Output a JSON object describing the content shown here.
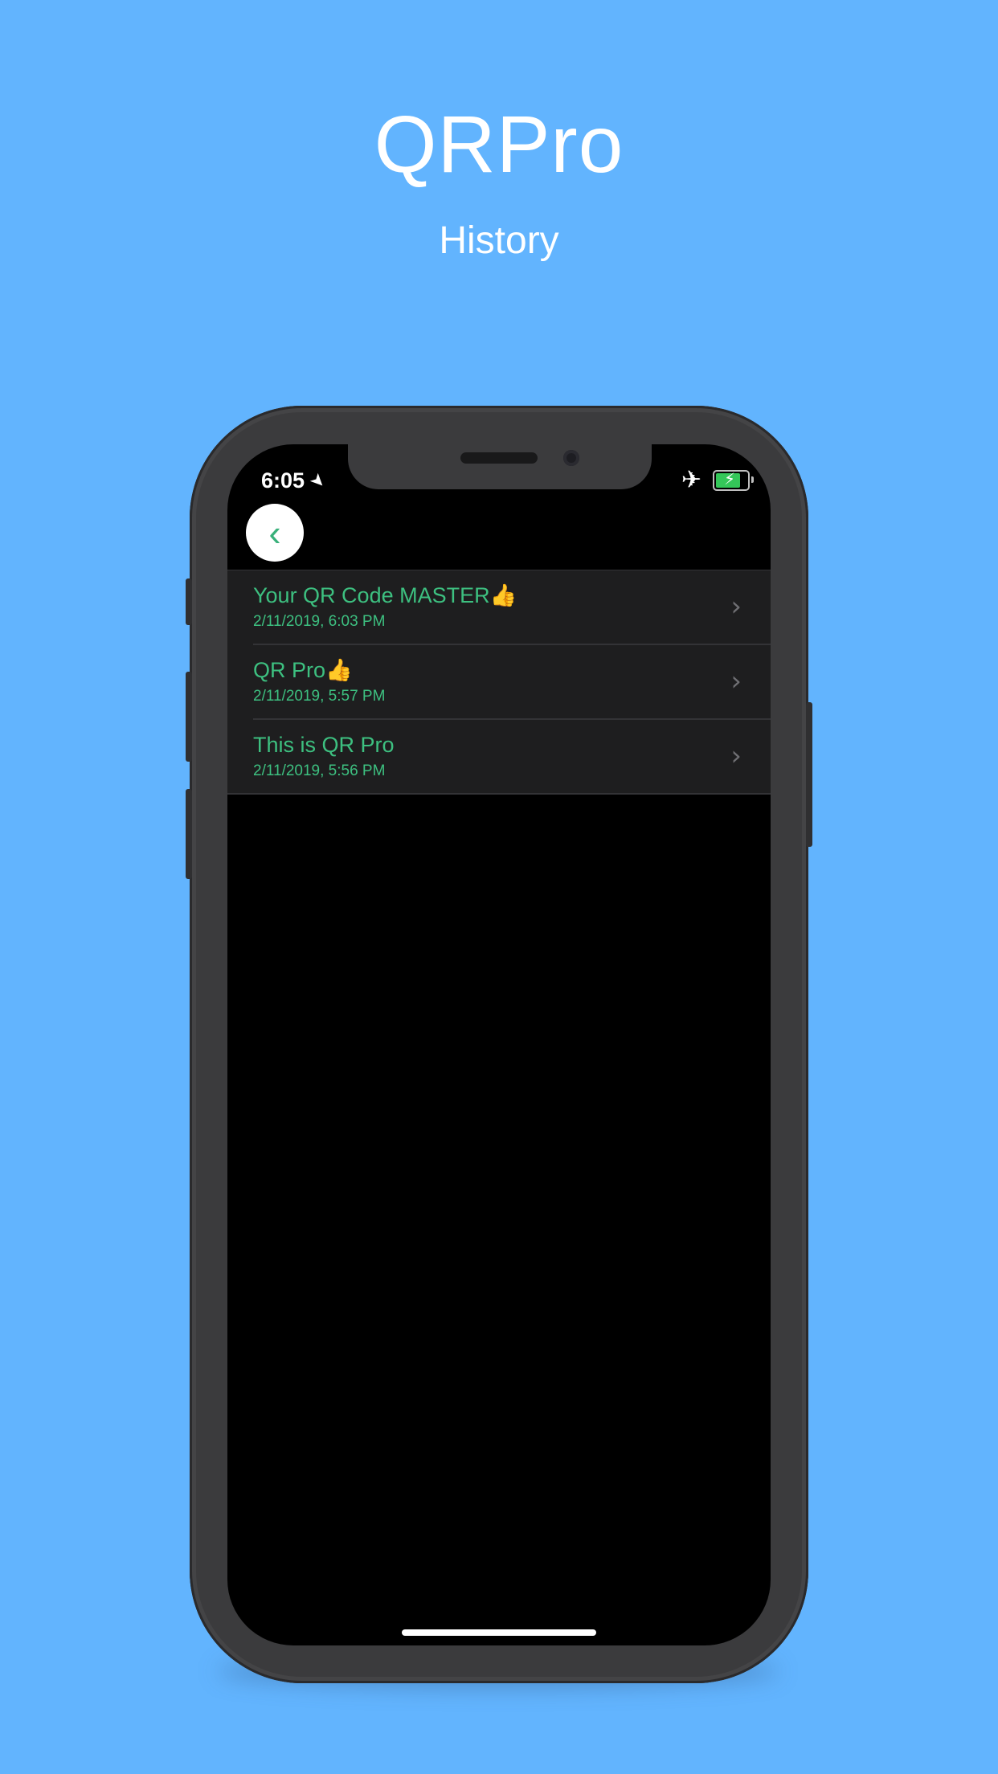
{
  "promo": {
    "title": "QRPro",
    "subtitle": "History"
  },
  "status_bar": {
    "time": "6:05",
    "location_icon": "location-arrow-icon",
    "airplane_icon": "airplane-icon",
    "battery_icon": "battery-charging-icon",
    "battery_level": 0.8
  },
  "nav": {
    "back_icon": "chevron-left-icon",
    "back_glyph": "‹"
  },
  "history": {
    "items": [
      {
        "title": "Your QR Code MASTER👍",
        "date": "2/11/2019, 6:03 PM"
      },
      {
        "title": "QR Pro👍",
        "date": "2/11/2019, 5:57 PM"
      },
      {
        "title": "This is QR Pro",
        "date": "2/11/2019, 5:56 PM"
      }
    ],
    "chevron_glyph": "›"
  },
  "colors": {
    "background": "#62b4fe",
    "accent_green": "#3dc080",
    "row_background": "#1e1e1f",
    "device_frame": "#3b3b3d"
  }
}
